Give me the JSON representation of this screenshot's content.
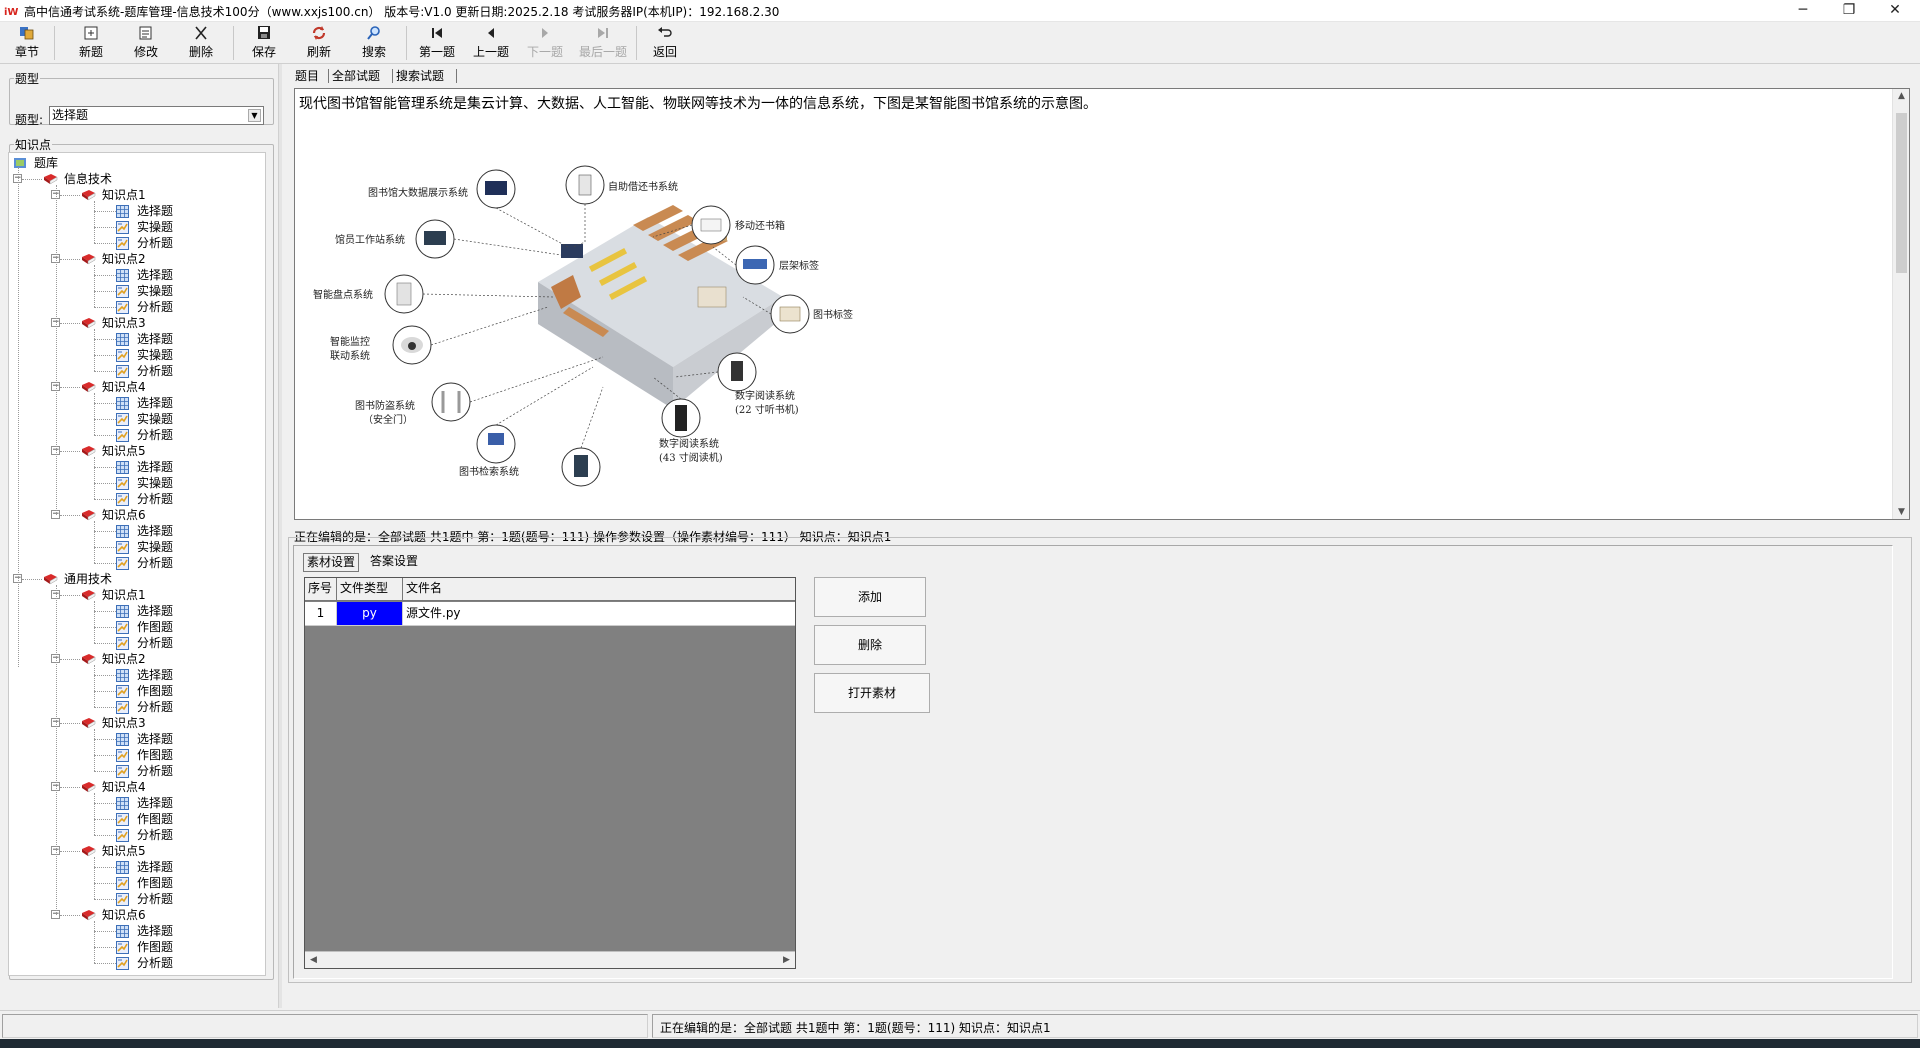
{
  "window": {
    "title": "高中信通考试系统-题库管理-信息技术100分（www.xxjs100.cn）  版本号:V1.0 更新日期:2025.2.18    考试服务器IP(本机IP)：192.168.2.30",
    "minimize_glyph": "─",
    "restore_glyph": "❐",
    "close_glyph": "✕"
  },
  "toolbar": [
    {
      "label": "章节",
      "icon": "chapter-icon",
      "enabled": true
    },
    {
      "label": "新题",
      "icon": "new-question-icon",
      "enabled": true
    },
    {
      "label": "修改",
      "icon": "edit-icon",
      "enabled": true
    },
    {
      "label": "删除",
      "icon": "delete-icon",
      "enabled": true
    },
    {
      "label": "保存",
      "icon": "save-icon",
      "enabled": true
    },
    {
      "label": "刷新",
      "icon": "refresh-icon",
      "enabled": true
    },
    {
      "label": "搜索",
      "icon": "search-icon",
      "enabled": true
    },
    {
      "label": "第一题",
      "icon": "first-icon",
      "enabled": true
    },
    {
      "label": "上一题",
      "icon": "prev-icon",
      "enabled": true
    },
    {
      "label": "下一题",
      "icon": "next-icon",
      "enabled": false
    },
    {
      "label": "最后一题",
      "icon": "last-icon",
      "enabled": false
    },
    {
      "label": "返回",
      "icon": "back-icon",
      "enabled": true
    }
  ],
  "left": {
    "type_group_title": "题型",
    "type_label": "题型:",
    "type_value": "选择题",
    "kp_group_title": "知识点"
  },
  "tree": {
    "root": "题库",
    "categories": [
      {
        "name": "信息技术",
        "points": [
          {
            "name": "知识点1",
            "items": [
              "选择题",
              "实操题",
              "分析题"
            ]
          },
          {
            "name": "知识点2",
            "items": [
              "选择题",
              "实操题",
              "分析题"
            ]
          },
          {
            "name": "知识点3",
            "items": [
              "选择题",
              "实操题",
              "分析题"
            ]
          },
          {
            "name": "知识点4",
            "items": [
              "选择题",
              "实操题",
              "分析题"
            ]
          },
          {
            "name": "知识点5",
            "items": [
              "选择题",
              "实操题",
              "分析题"
            ]
          },
          {
            "name": "知识点6",
            "items": [
              "选择题",
              "实操题",
              "分析题"
            ]
          }
        ]
      },
      {
        "name": "通用技术",
        "points": [
          {
            "name": "知识点1",
            "items": [
              "选择题",
              "作图题",
              "分析题"
            ]
          },
          {
            "name": "知识点2",
            "items": [
              "选择题",
              "作图题",
              "分析题"
            ]
          },
          {
            "name": "知识点3",
            "items": [
              "选择题",
              "作图题",
              "分析题"
            ]
          },
          {
            "name": "知识点4",
            "items": [
              "选择题",
              "作图题",
              "分析题"
            ]
          },
          {
            "name": "知识点5",
            "items": [
              "选择题",
              "作图题",
              "分析题"
            ]
          },
          {
            "name": "知识点6",
            "items": [
              "选择题",
              "作图题",
              "分析题"
            ]
          }
        ]
      }
    ]
  },
  "tabs": [
    "题目",
    "全部试题",
    "搜索试题"
  ],
  "question": {
    "text": "现代图书馆智能管理系统是集云计算、大数据、人工智能、物联网等技术为一体的信息系统，下图是某智能图书馆系统的示意图。",
    "diagram_labels": {
      "bigdata": "图书馆大数据展示系统",
      "selfreturn": "自助借还书系统",
      "mobilebox": "移动还书箱",
      "staff": "馆员工作站系统",
      "shelftag": "层架标签",
      "inventory": "智能盘点系统",
      "booktag": "图书标签",
      "monitor_1": "智能监控",
      "monitor_2": "联动系统",
      "reader22_1": "数字阅读系统",
      "reader22_2": "(22 寸听书机)",
      "antitheft_1": "图书防盗系统",
      "antitheft_2": "（安全门）",
      "reader43_1": "数字阅读系统",
      "reader43_2": "(43 寸阅读机)",
      "search": "图书检索系统"
    }
  },
  "editing_status": "正在编辑的是：全部试题 共1题中   第：1题(题号：111) 操作参数设置（操作素材编号：111）  知识点：知识点1",
  "subtabs": [
    "素材设置",
    "答案设置"
  ],
  "grid": {
    "columns": [
      "序号",
      "文件类型",
      "文件名"
    ],
    "rows": [
      {
        "no": "1",
        "type": "py",
        "name": "源文件.py"
      }
    ],
    "type_highlight": "#0000ff"
  },
  "buttons": {
    "add": "添加",
    "delete": "删除",
    "open": "打开素材"
  },
  "bottom_status": "正在编辑的是：全部试题 共1题中   第：1题(题号：111)   知识点：知识点1"
}
